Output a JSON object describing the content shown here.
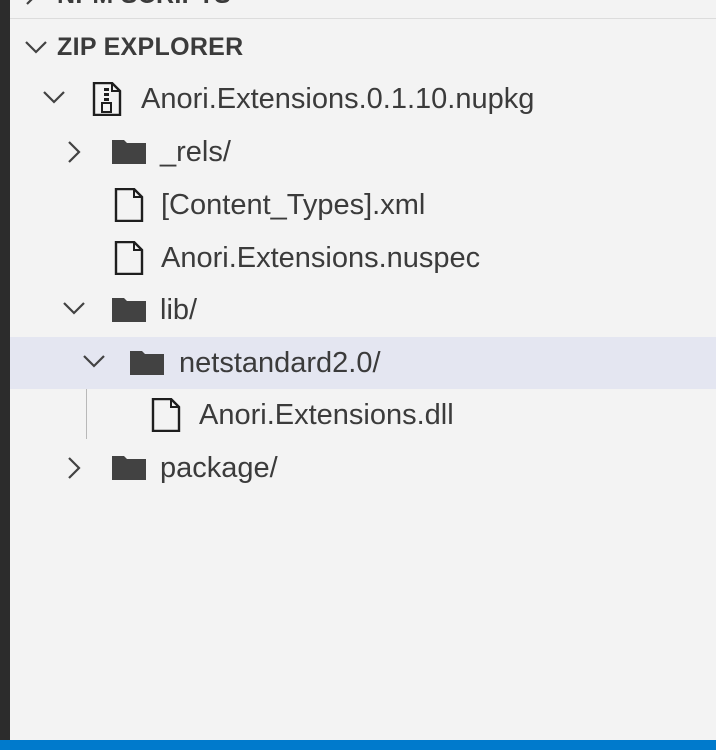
{
  "previous_section": {
    "title": "NPM SCRIPTS"
  },
  "section": {
    "title": "ZIP EXPLORER"
  },
  "tree": [
    {
      "label": "Anori.Extensions.0.1.10.nupkg",
      "kind": "archive",
      "state": "expanded"
    },
    {
      "label": "_rels/",
      "kind": "folder",
      "state": "collapsed"
    },
    {
      "label": "[Content_Types].xml",
      "kind": "file"
    },
    {
      "label": "Anori.Extensions.nuspec",
      "kind": "file"
    },
    {
      "label": "lib/",
      "kind": "folder",
      "state": "expanded"
    },
    {
      "label": "netstandard2.0/",
      "kind": "folder",
      "state": "expanded",
      "selected": true
    },
    {
      "label": "Anori.Extensions.dll",
      "kind": "file"
    },
    {
      "label": "package/",
      "kind": "folder",
      "state": "collapsed"
    }
  ],
  "colors": {
    "background": "#f3f3f3",
    "selected_row": "#e4e6f1",
    "status_bar": "#007acc",
    "activity_bar": "#2c2c2c"
  }
}
